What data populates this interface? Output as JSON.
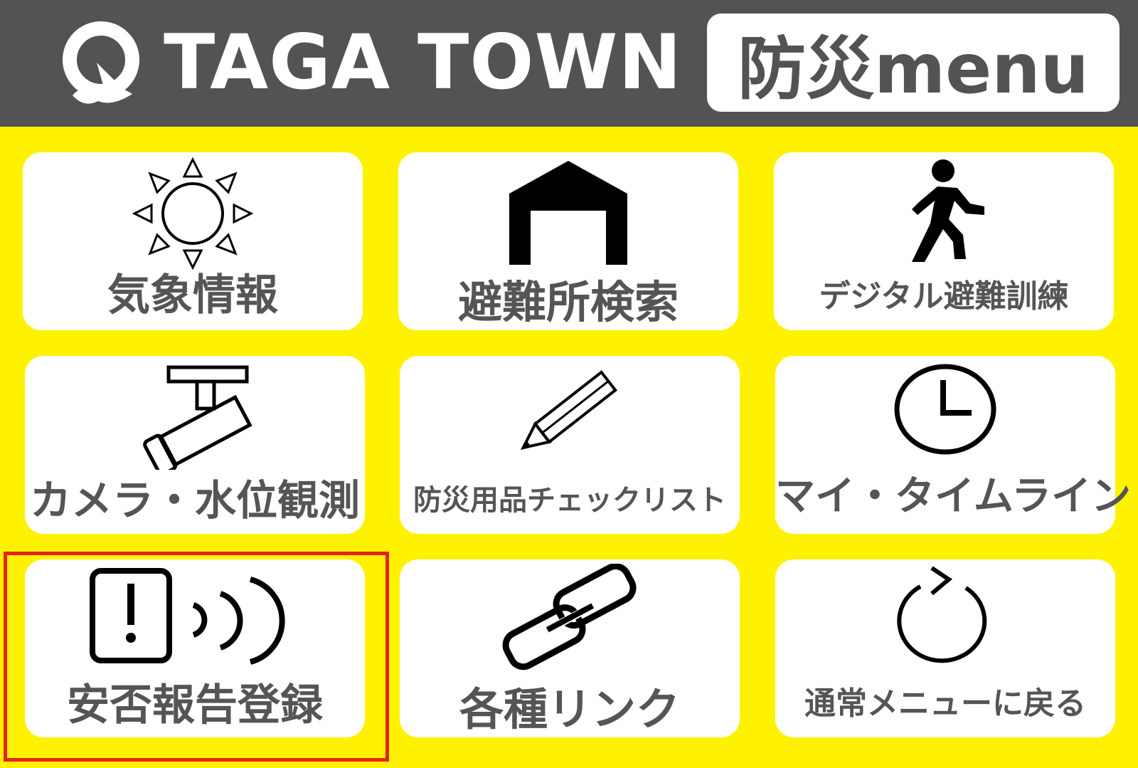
{
  "header": {
    "brand": "TAGA TOWN",
    "menu_title": "防災menu",
    "logo_icon": "taga-logo-icon"
  },
  "tiles": [
    {
      "label": "気象情報",
      "icon": "sun-icon"
    },
    {
      "label": "避難所検索",
      "icon": "shelter-icon"
    },
    {
      "label": "デジタル避難訓練",
      "icon": "running-person-icon"
    },
    {
      "label": "カメラ・水位観測",
      "icon": "security-camera-icon"
    },
    {
      "label": "防災用品チェックリスト",
      "icon": "pencil-icon"
    },
    {
      "label": "マイ・タイムライン",
      "icon": "clock-icon"
    },
    {
      "label": "安否報告登録",
      "icon": "alert-signal-icon"
    },
    {
      "label": "各種リンク",
      "icon": "link-icon"
    },
    {
      "label": "通常メニューに戻る",
      "icon": "refresh-icon"
    }
  ],
  "colors": {
    "background": "#FFF200",
    "header": "#535353",
    "tile": "#FFFFFF",
    "text": "#555555",
    "highlight": "#E5231B"
  }
}
